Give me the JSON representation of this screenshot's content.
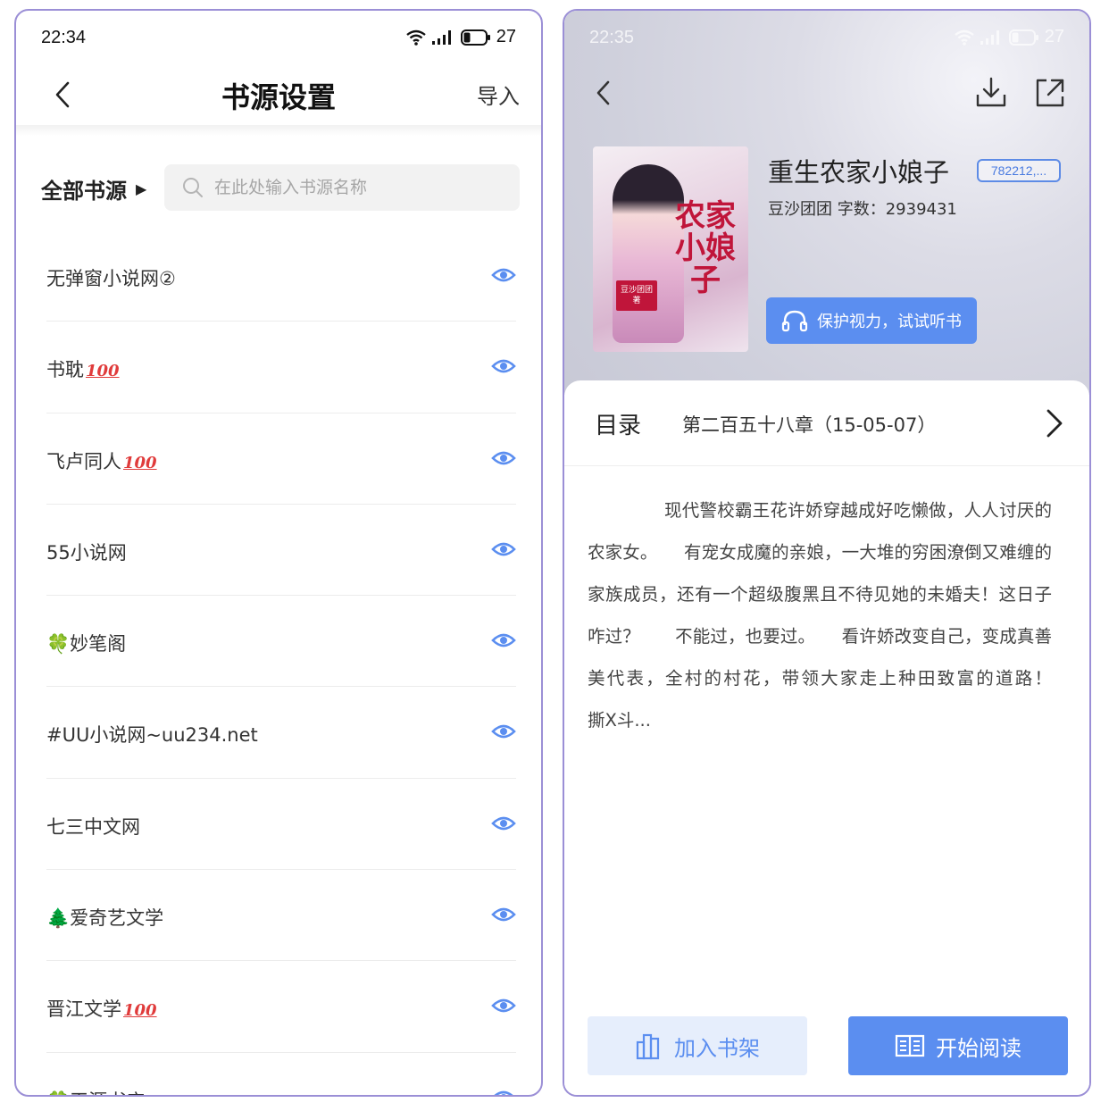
{
  "left": {
    "status": {
      "time": "22:34",
      "battery": "27"
    },
    "nav": {
      "title": "书源设置",
      "import_label": "导入",
      "back_icon": "chevron-left-icon"
    },
    "filter": {
      "label": "全部书源",
      "search_placeholder": "在此处输入书源名称"
    },
    "sources": [
      {
        "name": "无弹窗小说网②",
        "badge": ""
      },
      {
        "name": "书耽",
        "badge": "100"
      },
      {
        "name": "飞卢同人",
        "badge": "100"
      },
      {
        "name": "55小说网",
        "badge": ""
      },
      {
        "name": "🍀妙笔阁",
        "badge": ""
      },
      {
        "name": "#UU小说网~uu234.net",
        "badge": ""
      },
      {
        "name": "七三中文网",
        "badge": ""
      },
      {
        "name": "🌲爱奇艺文学",
        "badge": ""
      },
      {
        "name": "晋江文学",
        "badge": "100"
      },
      {
        "name": "🍀天源书店",
        "badge": ""
      }
    ]
  },
  "right": {
    "status": {
      "time": "22:35",
      "battery": "27"
    },
    "cover": {
      "title_text": "农家小娘子",
      "stamp_text": "豆沙团团 著"
    },
    "book": {
      "title": "重生农家小娘子",
      "id_badge": "782212,...",
      "meta": "豆沙团团 字数：2939431",
      "listen_label": "保护视力，试试听书"
    },
    "toc": {
      "label": "目录",
      "latest_chapter": "第二百五十八章（15-05-07）"
    },
    "synopsis": "现代警校霸王花许娇穿越成好吃懒做，人人讨厌的农家女。　　有宠女成魔的亲娘，一大堆的穷困潦倒又难缠的家族成员，还有一个超级腹黑且不待见她的未婚夫！这日子咋过？　　不能过，也要过。　　看许娇改变自己，变成真善美代表，全村的村花，带领大家走上种田致富的道路！　　撕X斗...",
    "buttons": {
      "shelf_label": "加入书架",
      "read_label": "开始阅读"
    }
  },
  "colors": {
    "accent": "#5b8ef0",
    "frame": "#9b8fd6",
    "badge_red": "#e03b3b"
  }
}
